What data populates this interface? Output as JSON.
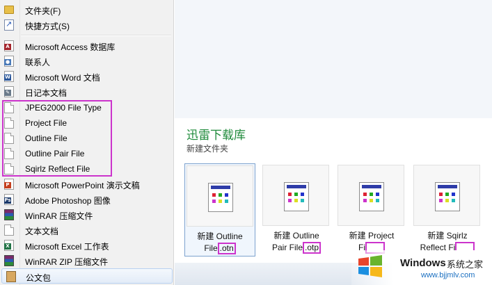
{
  "menu": {
    "items": [
      {
        "label": "文件夹(F)",
        "icon": "folder-icon"
      },
      {
        "label": "快捷方式(S)",
        "icon": "shortcut-icon"
      },
      {
        "label": "Microsoft Access 数据库",
        "icon": "access-icon"
      },
      {
        "label": "联系人",
        "icon": "contact-icon"
      },
      {
        "label": "Microsoft Word 文档",
        "icon": "word-icon"
      },
      {
        "label": "日记本文档",
        "icon": "journal-icon"
      },
      {
        "label": "JPEG2000 File Type",
        "icon": "blank-document-icon"
      },
      {
        "label": "Project File",
        "icon": "blank-document-icon"
      },
      {
        "label": "Outline File",
        "icon": "blank-document-icon"
      },
      {
        "label": "Outline Pair File",
        "icon": "blank-document-icon"
      },
      {
        "label": "Sqirlz Reflect File",
        "icon": "blank-document-icon"
      },
      {
        "label": "Microsoft PowerPoint 演示文稿",
        "icon": "powerpoint-icon"
      },
      {
        "label": "Adobe Photoshop 图像",
        "icon": "photoshop-icon"
      },
      {
        "label": "WinRAR 压缩文件",
        "icon": "winrar-icon"
      },
      {
        "label": "文本文档",
        "icon": "text-document-icon"
      },
      {
        "label": "Microsoft Excel 工作表",
        "icon": "excel-icon"
      },
      {
        "label": "WinRAR ZIP 压缩文件",
        "icon": "winrar-zip-icon"
      },
      {
        "label": "公文包",
        "icon": "briefcase-icon"
      }
    ]
  },
  "folder": {
    "title": "迅雷下载库",
    "subtitle": "新建文件夹"
  },
  "files": [
    {
      "name_line1": "新建 Outline",
      "name_line2_prefix": "File",
      "ext": ".otn"
    },
    {
      "name_line1": "新建 Outline",
      "name_line2_prefix": "Pair File",
      "ext": ".otp"
    },
    {
      "name_line1": "新建 Project",
      "name_line2_prefix": "Fi",
      "ext": ""
    },
    {
      "name_line1": "新建 Sqirlz",
      "name_line2_prefix": "Reflect Fi",
      "ext": ""
    }
  ],
  "watermark": {
    "brand": "Windows",
    "site_cn": "系统之家",
    "url": "www.bjjmlv.com"
  },
  "colors": {
    "highlight": "#cc33cc",
    "folder_title": "#1e8a3a"
  }
}
